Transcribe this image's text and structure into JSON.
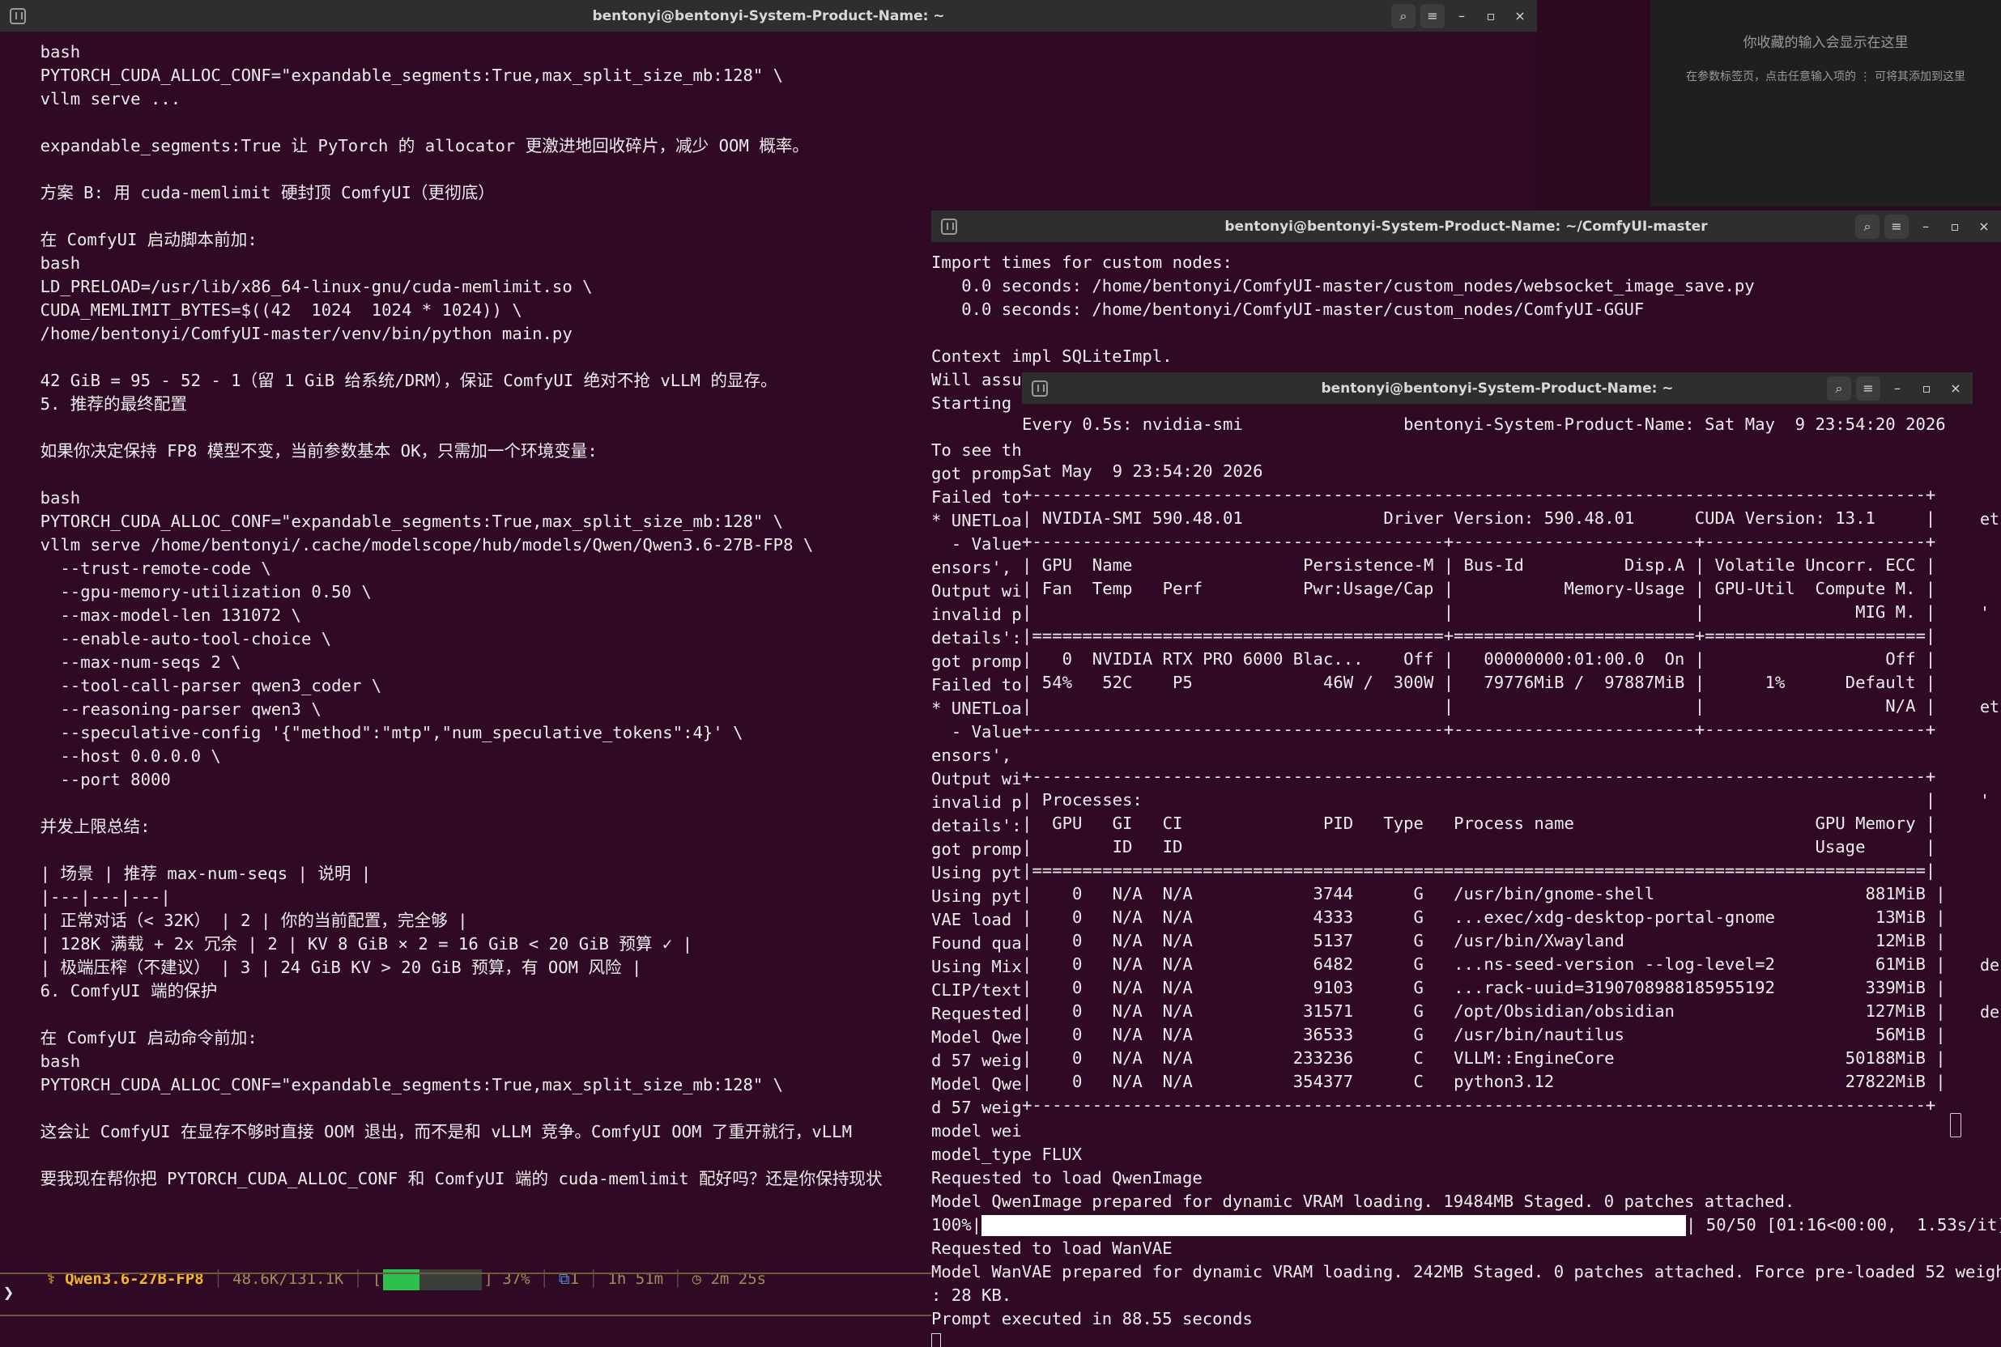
{
  "win1": {
    "title": "bentonyi@bentonyi-System-Product-Name: ~",
    "lines": [
      "    bash",
      "    PYTORCH_CUDA_ALLOC_CONF=\"expandable_segments:True,max_split_size_mb:128\" \\",
      "    vllm serve ...",
      "",
      "    expandable_segments:True 让 PyTorch 的 allocator 更激进地回收碎片，减少 OOM 概率。",
      "",
      "    方案 B: 用 cuda-memlimit 硬封顶 ComfyUI（更彻底）",
      "",
      "    在 ComfyUI 启动脚本前加:",
      "    bash",
      "    LD_PRELOAD=/usr/lib/x86_64-linux-gnu/cuda-memlimit.so \\",
      "    CUDA_MEMLIMIT_BYTES=$((42  1024  1024 * 1024)) \\",
      "    /home/bentonyi/ComfyUI-master/venv/bin/python main.py",
      "",
      "    42 GiB = 95 - 52 - 1（留 1 GiB 给系统/DRM），保证 ComfyUI 绝对不抢 vLLM 的显存。",
      "    5. 推荐的最终配置",
      "",
      "    如果你决定保持 FP8 模型不变，当前参数基本 OK，只需加一个环境变量:",
      "",
      "    bash",
      "    PYTORCH_CUDA_ALLOC_CONF=\"expandable_segments:True,max_split_size_mb:128\" \\",
      "    vllm serve /home/bentonyi/.cache/modelscope/hub/models/Qwen/Qwen3.6-27B-FP8 \\",
      "      --trust-remote-code \\",
      "      --gpu-memory-utilization 0.50 \\",
      "      --max-model-len 131072 \\",
      "      --enable-auto-tool-choice \\",
      "      --max-num-seqs 2 \\",
      "      --tool-call-parser qwen3_coder \\",
      "      --reasoning-parser qwen3 \\",
      "      --speculative-config '{\"method\":\"mtp\",\"num_speculative_tokens\":4}' \\",
      "      --host 0.0.0.0 \\",
      "      --port 8000",
      "",
      "    并发上限总结:",
      "",
      "    | 场景 | 推荐 max-num-seqs | 说明 |",
      "    |---|---|---|",
      "    | 正常对话（< 32K） | 2 | 你的当前配置，完全够 |",
      "    | 128K 满载 + 2x 冗余 | 2 | KV 8 GiB × 2 = 16 GiB < 20 GiB 预算 ✓ |",
      "    | 极端压榨（不建议） | 3 | 24 GiB KV > 20 GiB 预算，有 OOM 风险 |",
      "    6. ComfyUI 端的保护",
      "",
      "    在 ComfyUI 启动命令前加:",
      "    bash",
      "    PYTORCH_CUDA_ALLOC_CONF=\"expandable_segments:True,max_split_size_mb:128\" \\",
      "",
      "    这会让 ComfyUI 在显存不够时直接 OOM 退出，而不是和 vLLM 竞争。ComfyUI OOM 了重开就行，vLLM",
      "",
      "    要我现在帮你把 PYTORCH_CUDA_ALLOC_CONF 和 ComfyUI 端的 cuda-memlimit 配好吗？还是你保持现状"
    ],
    "status": {
      "model": "Qwen3.6-27B-FP8",
      "tokens": "48.6K/131.1K",
      "progress_percent": 37,
      "progress_label": "37%",
      "tasks": "1",
      "time1": "1h 51m",
      "time2": "2m 25s"
    },
    "prompt_symbol": "❯"
  },
  "right_panel": {
    "text1": "你收藏的输入会显示在这里",
    "text2": "在参数标签页，点击任意输入项的 ⋮ 可将其添加到这里"
  },
  "win2": {
    "title": "bentonyi@bentonyi-System-Product-Name: ~/ComfyUI-master",
    "lines": [
      "Import times for custom nodes:",
      "   0.0 seconds: /home/bentonyi/ComfyUI-master/custom_nodes/websocket_image_save.py",
      "   0.0 seconds: /home/bentonyi/ComfyUI-master/custom_nodes/ComfyUI-GGUF",
      "",
      "Context impl SQLiteImpl.",
      "Will assu",
      "Starting",
      "",
      "To see th",
      "got promp",
      "Failed to",
      "* UNETLoa",
      "  - Value",
      "ensors',",
      "Output wi",
      "invalid p",
      "details':",
      "got promp",
      "Failed to",
      "* UNETLoa",
      "  - Value",
      "ensors',",
      "Output wi",
      "invalid p",
      "details':",
      "got promp",
      "Using pyt",
      "Using pyt",
      "VAE load",
      "Found qua",
      "Using Mix",
      "CLIP/text",
      "Requested",
      "Model Qwe",
      "d 57 weig",
      "Model Qwe",
      "d 57 weig",
      "model wei",
      "model_type FLUX",
      "Requested to load QwenImage",
      "Model QwenImage prepared for dynamic VRAM loading. 19484MB Staged. 0 patches attached."
    ],
    "progress_prefix": "100%|",
    "progress_percent": 100,
    "progress_suffix": "| 50/50 [01:16<00:00,  1.53s/it]",
    "lines_after": [
      "Requested to load WanVAE",
      "Model WanVAE prepared for dynamic VRAM loading. 242MB Staged. 0 patches attached. Force pre-loaded 52 weights",
      ": 28 KB.",
      "Prompt executed in 88.55 seconds"
    ],
    "right_edge": [
      "et",
      "'",
      "et",
      "'",
      "de",
      "de"
    ]
  },
  "win3": {
    "title": "bentonyi@bentonyi-System-Product-Name: ~",
    "lines": [
      "Every 0.5s: nvidia-smi                bentonyi-System-Product-Name: Sat May  9 23:54:20 2026",
      "",
      "Sat May  9 23:54:20 2026",
      "+-----------------------------------------------------------------------------------------+",
      "| NVIDIA-SMI 590.48.01              Driver Version: 590.48.01      CUDA Version: 13.1     |",
      "+-----------------------------------------+------------------------+----------------------+",
      "| GPU  Name                 Persistence-M | Bus-Id          Disp.A | Volatile Uncorr. ECC |",
      "| Fan  Temp   Perf          Pwr:Usage/Cap |           Memory-Usage | GPU-Util  Compute M. |",
      "|                                         |                        |               MIG M. |",
      "|=========================================+========================+======================|",
      "|   0  NVIDIA RTX PRO 6000 Blac...    Off |   00000000:01:00.0  On |                  Off |",
      "| 54%   52C    P5             46W /  300W |   79776MiB /  97887MiB |      1%      Default |",
      "|                                         |                        |                  N/A |",
      "+-----------------------------------------+------------------------+----------------------+",
      "",
      "+-----------------------------------------------------------------------------------------+",
      "| Processes:                                                                              |",
      "|  GPU   GI   CI              PID   Type   Process name                        GPU Memory |",
      "|        ID   ID                                                               Usage      |",
      "|=========================================================================================|",
      "|    0   N/A  N/A            3744      G   /usr/bin/gnome-shell                     881MiB |",
      "|    0   N/A  N/A            4333      G   ...exec/xdg-desktop-portal-gnome          13MiB |",
      "|    0   N/A  N/A            5137      G   /usr/bin/Xwayland                         12MiB |",
      "|    0   N/A  N/A            6482      G   ...ns-seed-version --log-level=2          61MiB |",
      "|    0   N/A  N/A            9103      G   ...rack-uuid=3190708988185955192         339MiB |",
      "|    0   N/A  N/A           31571      G   /opt/Obsidian/obsidian                   127MiB |",
      "|    0   N/A  N/A           36533      G   /usr/bin/nautilus                         56MiB |",
      "|    0   N/A  N/A          233236      C   VLLM::EngineCore                       50188MiB |",
      "|    0   N/A  N/A          354377      C   python3.12                             27822MiB |",
      "+-----------------------------------------------------------------------------------------+"
    ]
  }
}
